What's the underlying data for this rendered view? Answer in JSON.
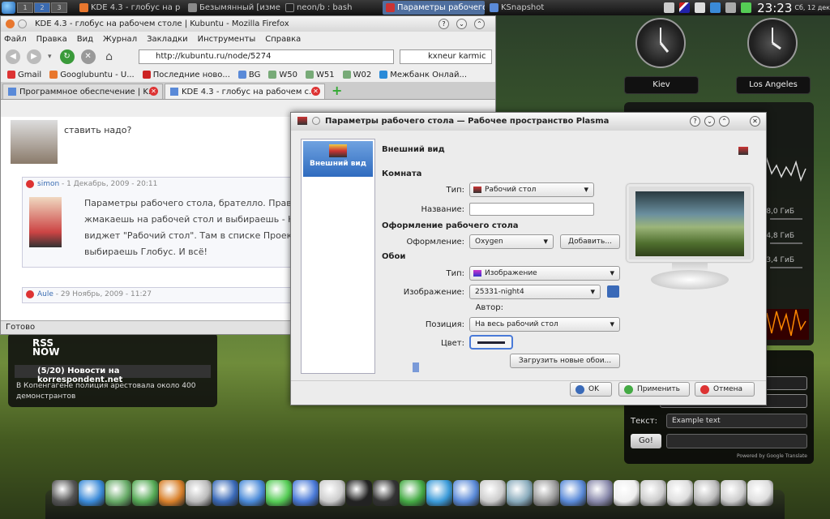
{
  "taskbar": {
    "pagers": [
      "1",
      "2",
      "3"
    ],
    "tasks": [
      {
        "label": "KDE 4.3 - глобус на р",
        "color": "#e8772e"
      },
      {
        "label": "Безымянный [изменё",
        "color": "#8a8a8a"
      },
      {
        "label": "neon/b : bash",
        "color": "#222222"
      },
      {
        "label": "Параметры рабочего",
        "color": "#c33333",
        "active": true
      },
      {
        "label": "KSnapshot",
        "color": "#5a8ad8"
      }
    ],
    "clock": "23:23",
    "date": "Сб, 12 дек"
  },
  "clocks": [
    {
      "city": "Kiev"
    },
    {
      "city": "Los Angeles"
    }
  ],
  "sysmon": {
    "values": [
      "8,0 ГиБ",
      "4,8 ГиБ",
      "3,4 ГиБ"
    ]
  },
  "form_widget": {
    "text_label": "Текст:",
    "text_value": "Example text",
    "go_label": "Go!",
    "powered": "Powered by Google Translate"
  },
  "rss": {
    "logo_top": "RSS",
    "logo_bottom": "NOW",
    "headline": "(5/20) Новости на korrespondent.net",
    "item": "В Копенгагене полиция арестовала около 400 демонстрантов"
  },
  "firefox": {
    "title": "KDE 4.3 - глобус на рабочем столе | Kubuntu - Mozilla Firefox",
    "menu": [
      "Файл",
      "Правка",
      "Вид",
      "Журнал",
      "Закладки",
      "Инструменты",
      "Справка"
    ],
    "url": "http://kubuntu.ru/node/5274",
    "search": "kxneur karmic",
    "bookmarks": [
      {
        "label": "Gmail",
        "color": "#d33"
      },
      {
        "label": "Googlubuntu - U...",
        "color": "#e8772e"
      },
      {
        "label": "Последние ново...",
        "color": "#c22"
      },
      {
        "label": "BG",
        "color": "#5a8ad8"
      },
      {
        "label": "W50",
        "color": "#7a7"
      },
      {
        "label": "W51",
        "color": "#7a7"
      },
      {
        "label": "W02",
        "color": "#7a7"
      },
      {
        "label": "Межбанк Онлай...",
        "color": "#2a8ad8"
      }
    ],
    "tabs": [
      {
        "label": "Программное обеспечение | K..."
      },
      {
        "label": "KDE 4.3 - глобус на рабочем с...",
        "active": true
      }
    ],
    "comment1_text": "ставить надо?",
    "comments": [
      {
        "author": "simon",
        "date": " - 1 Декабрь, 2009 - 20:11",
        "text": "Параметры рабочего стола, брателло. Правой жмакаешь на рабочей стол и выбираешь - На виджет \"Рабочий стол\". Там в списке Проекц выбираешь Глобус. И всё!"
      },
      {
        "author": "Aule",
        "date": " - 29 Ноябрь, 2009 - 11:27"
      }
    ],
    "status": "Готово"
  },
  "dialog": {
    "title": "Параметры рабочего стола — Рабочее пространство Plasma",
    "sidebar_item": "Внешний вид",
    "page_header": "Внешний вид",
    "section_room": "Комната",
    "type_label": "Тип:",
    "type_value": "Рабочий стол",
    "name_label": "Название:",
    "section_design": "Оформление рабочего стола",
    "theme_label": "Оформление:",
    "theme_value": "Oxygen",
    "add_button": "Добавить...",
    "section_wallpaper": "Обои",
    "wp_type_label": "Тип:",
    "wp_type_value": "Изображение",
    "image_label": "Изображение:",
    "image_value": "25331-night4",
    "author_label": "Автор:",
    "position_label": "Позиция:",
    "position_value": "На весь рабочий стол",
    "color_label": "Цвет:",
    "download_button": "Загрузить новые обои...",
    "ok": "OK",
    "apply": "Применить",
    "cancel": "Отмена"
  },
  "dock": {
    "icon_colors": [
      "#555",
      "#3a8ad8",
      "#6a6",
      "#5a5",
      "#d8802a",
      "#bbb",
      "#3a6ab8",
      "#4a8ad8",
      "#5c5",
      "#4a7ad8",
      "#ccc",
      "#222",
      "#333",
      "#4a4",
      "#3a9ad8",
      "#5a8ad8",
      "#ccc",
      "#8ab",
      "#999",
      "#5a8ad8",
      "#88a",
      "#eee",
      "#ccc",
      "#ddd",
      "#bbb",
      "#ccc",
      "#ddd"
    ]
  }
}
